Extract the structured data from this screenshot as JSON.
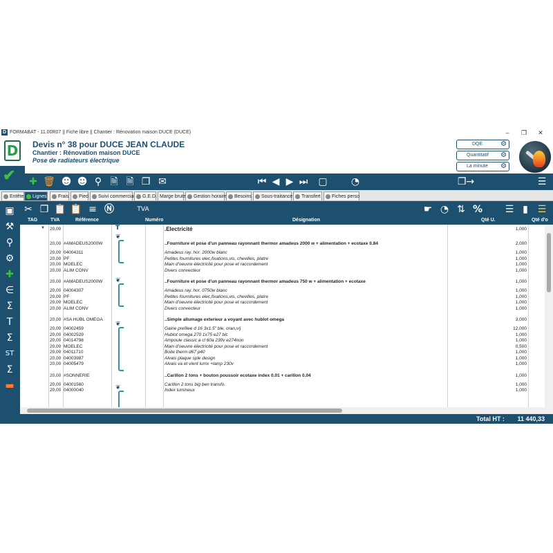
{
  "window": {
    "title": "FORMABAT - 11.00R07 || Fiche libre || Chantier : Rénovation maison DUCE (DUCE)",
    "app_icon": "D"
  },
  "header": {
    "title": "Devis n° 38 pour DUCE JEAN CLAUDE",
    "subtitle": "Chantier : Rénovation maison DUCE",
    "description": "Pose de radiateurs électrique",
    "buttons": [
      "DQE",
      "Quantitatif",
      "La minute"
    ],
    "logo_letter": "D"
  },
  "tabs": [
    "Entête",
    "Lignes",
    "Frais",
    "Pied",
    "Suivi commercial",
    "G.E.D.",
    "Marge brute",
    "Gestion horaire",
    "Besoins",
    "Sous-traitance",
    "Transfert",
    "Fiches perso"
  ],
  "tab_active_index": 1,
  "grid": {
    "columns": [
      "TAG",
      "TVA",
      "Référence",
      "Numéro",
      "Désignation",
      "Qté U.",
      "Qté d'o"
    ],
    "rows": [
      {
        "kind": "sec",
        "tva": "20,00",
        "ref": "",
        "des": ".Electricité",
        "qte": "1,000"
      },
      {
        "kind": "art",
        "tva": "20,00",
        "ref": "#AMADEUS2000W",
        "des": "..Fourniture et pose d'un panneau rayonnant thermor  amadeus 2000 w + alimentation + ecotaxe 0.84",
        "qte": "2,000"
      },
      {
        "kind": "sub",
        "tva": "20,00",
        "ref": "04004311",
        "des": "Amadeus ray. hor. 2000w blanc",
        "qte": "1,000"
      },
      {
        "kind": "sub",
        "tva": "20,00",
        "ref": "PF",
        "des": "Petites fournitures elec,fixations,vis, chevilles, platre",
        "qte": "1,000"
      },
      {
        "kind": "sub",
        "tva": "20,00",
        "ref": "MOELEC",
        "des": "Main d'oeuvre électricité pour pose et raccordement",
        "qte": "1,000"
      },
      {
        "kind": "sub",
        "tva": "20,00",
        "ref": "ALIM CONV",
        "des": "Divers convecteur",
        "qte": "1,000"
      },
      {
        "kind": "art",
        "tva": "20,00",
        "ref": "#AMADEUS2000W",
        "des": "..Fourniture et pose d'un panneau rayonnant thermor amadeus 750 w + alimentation + ecotaxe",
        "qte": "1,000"
      },
      {
        "kind": "sub",
        "tva": "20,00",
        "ref": "04004307",
        "des": "Amadeus ray. hor. 0750w blanc",
        "qte": "1,000"
      },
      {
        "kind": "sub",
        "tva": "20,00",
        "ref": "PF",
        "des": "Petites fournitures elec,fixations,vis, chevilles, platre",
        "qte": "1,000"
      },
      {
        "kind": "sub",
        "tva": "20,00",
        "ref": "MOELEC",
        "des": "Main d'oeuvre électricité pour pose et raccordement",
        "qte": "1,000"
      },
      {
        "kind": "sub",
        "tva": "20,00",
        "ref": "ALIM CONV",
        "des": "Divers convecteur",
        "qte": "1,000"
      },
      {
        "kind": "art",
        "tva": "20,00",
        "ref": "#SA HUBL OMEGA",
        "des": "..Simple allumage exterieur a voyant avec hublot omega",
        "qte": "3,000"
      },
      {
        "kind": "sub",
        "tva": "20,00",
        "ref": "04002459",
        "des": "Gaine prefilee d 16 3x1.5\" ble, oran,v/j",
        "qte": "12,000"
      },
      {
        "kind": "sub",
        "tva": "20,00",
        "ref": "04002529",
        "des": "Hublot omega 270 1x75 e27 blc",
        "qte": "1,000"
      },
      {
        "kind": "sub",
        "tva": "20,00",
        "ref": "04014798",
        "des": "Ampoule classic a cl 60a 230v e274non",
        "qte": "1,000"
      },
      {
        "kind": "sub",
        "tva": "20,00",
        "ref": "MOELEC",
        "des": "Main d'oeuvre électricité pour pose et raccordement",
        "qte": "0,500"
      },
      {
        "kind": "sub",
        "tva": "20,00",
        "ref": "04011710",
        "des": "Boite therm d67 p40",
        "qte": "1,000"
      },
      {
        "kind": "sub",
        "tva": "20,00",
        "ref": "04003987",
        "des": "Alvais plaque sple design",
        "qte": "1,000"
      },
      {
        "kind": "sub",
        "tva": "20,00",
        "ref": "04005479",
        "des": "Alvais va et vient lumx +lamp 230v",
        "qte": "1,000"
      },
      {
        "kind": "art",
        "tva": "20,00",
        "ref": "#SONNERIE",
        "des": "..Carillon 2 tons + bouton poussoir      ecotaxe index 0.01 + carillon 0.04",
        "qte": "1,000"
      },
      {
        "kind": "sub",
        "tva": "20,00",
        "ref": "04001560",
        "des": "Carillon 2 tons big ben transfo.",
        "qte": "1,000"
      },
      {
        "kind": "sub",
        "tva": "20,00",
        "ref": "04000040",
        "des": "Index lumineux",
        "qte": "1,000"
      }
    ]
  },
  "footer": {
    "total_label": "Total HT :",
    "total_value": "11 440,33"
  }
}
